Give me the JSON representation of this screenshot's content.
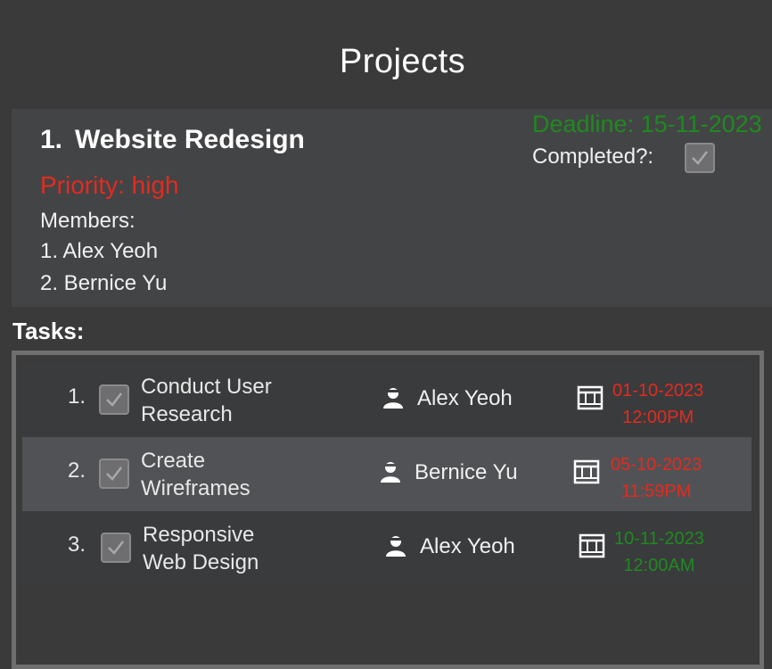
{
  "page": {
    "title": "Projects"
  },
  "project": {
    "number": "1.",
    "name": "Website Redesign",
    "priority": "Priority: high",
    "members_label": "Members:",
    "members": [
      "1. Alex Yeoh",
      "2. Bernice Yu"
    ],
    "deadline": "Deadline: 15-11-2023",
    "completed_label": "Completed?:",
    "completed": true
  },
  "tasks_label": "Tasks:",
  "tasks": [
    {
      "number": "1.",
      "name_line1": "Conduct User",
      "name_line2": "Research",
      "assignee": "Alex Yeoh",
      "date": "01-10-2023",
      "time": "12:00PM",
      "done": true,
      "date_color": "#e32b1f"
    },
    {
      "number": "2.",
      "name_line1": "Create",
      "name_line2": "Wireframes",
      "assignee": "Bernice Yu",
      "date": "05-10-2023",
      "time": "11:59PM",
      "done": true,
      "date_color": "#e32b1f"
    },
    {
      "number": "3.",
      "name_line1": "Responsive",
      "name_line2": "Web Design",
      "assignee": "Alex Yeoh",
      "date": "10-11-2023",
      "time": "12:00AM",
      "done": true,
      "date_color": "#1f8a1f"
    }
  ],
  "colors": {
    "background": "#3a3a3b",
    "card": "#434446",
    "priority_high": "#e32b1f",
    "deadline": "#1f8a1f",
    "row_highlight": "#505255"
  }
}
